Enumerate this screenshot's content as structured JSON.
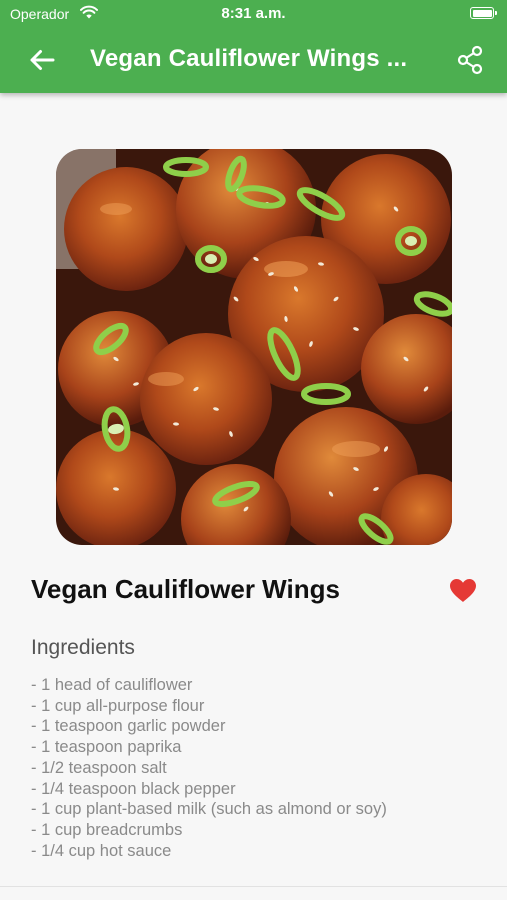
{
  "status_bar": {
    "carrier": "Operador",
    "time": "8:31 a.m."
  },
  "app_bar": {
    "title": "Vegan Cauliflower Wings ...",
    "back_icon": "arrow-left-icon",
    "share_icon": "share-icon",
    "color": "#4caf50"
  },
  "recipe": {
    "image_icon": "food-photo",
    "title": "Vegan Cauliflower Wings",
    "favorite_icon": "heart-icon",
    "favorite_color": "#e53935",
    "favorited": true,
    "ingredients_heading": "Ingredients",
    "ingredients": [
      "- 1 head of cauliflower",
      "- 1 cup all-purpose flour",
      "- 1 teaspoon garlic powder",
      "- 1 teaspoon paprika",
      "- 1/2 teaspoon salt",
      "- 1/4 teaspoon black pepper",
      "- 1 cup plant-based milk (such as almond or soy)",
      "- 1 cup breadcrumbs",
      "- 1/4 cup hot sauce"
    ]
  }
}
